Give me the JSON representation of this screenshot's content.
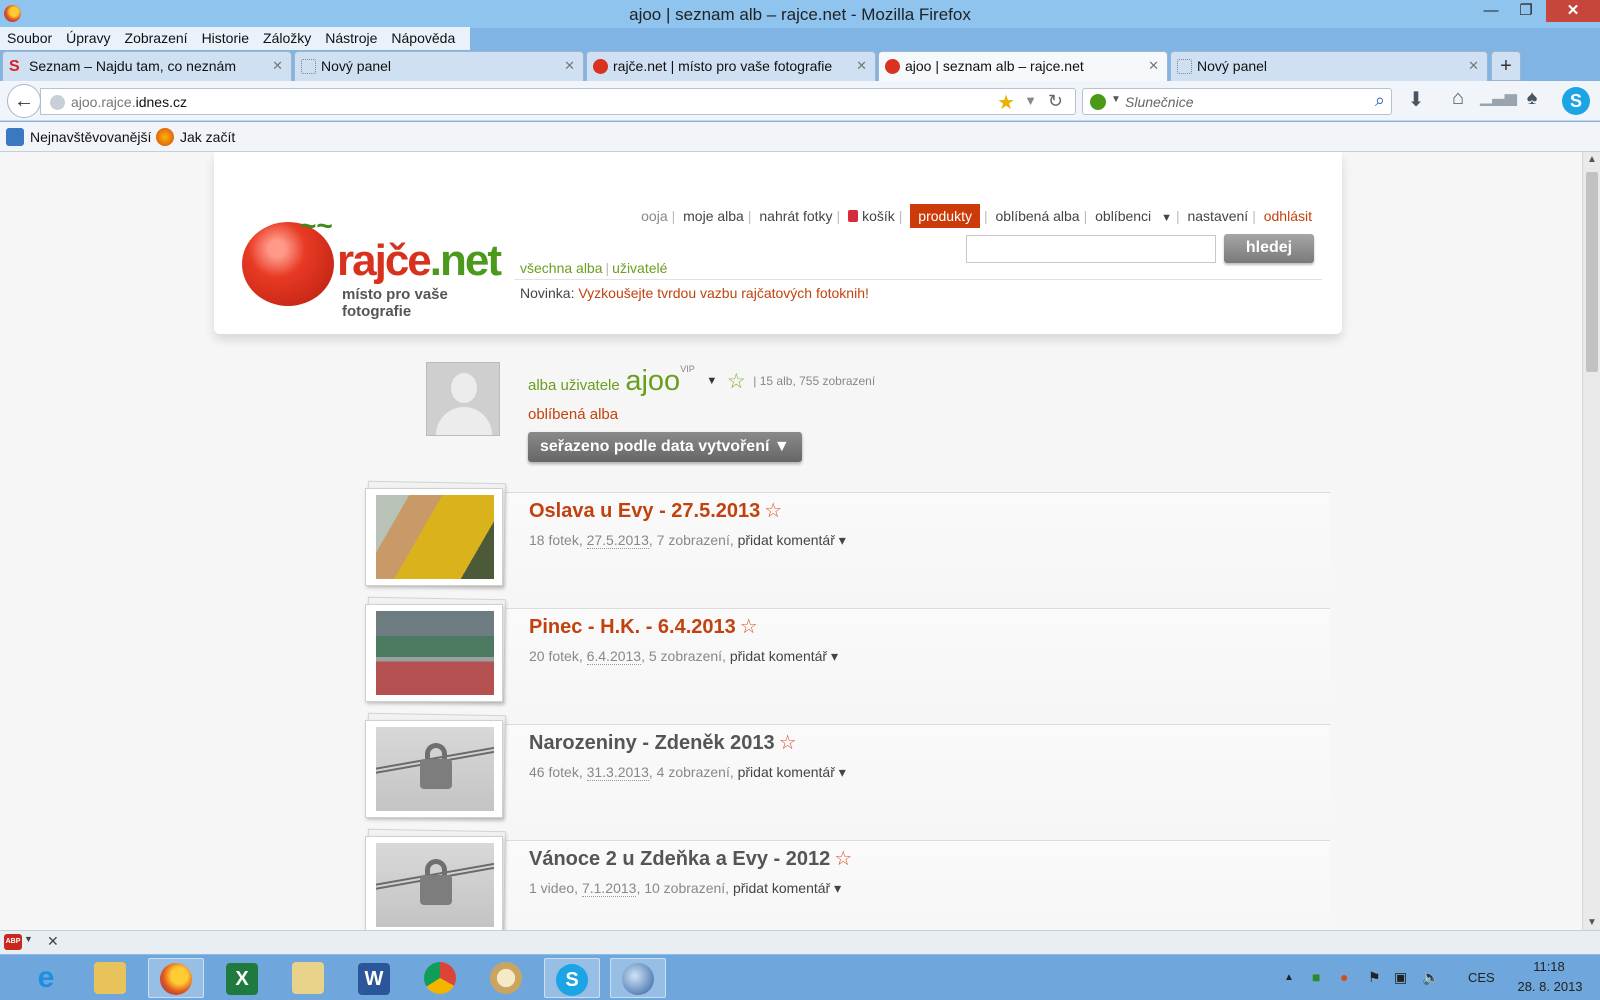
{
  "window": {
    "title": "ajoo | seznam alb – rajce.net - Mozilla Firefox"
  },
  "menu": [
    "Soubor",
    "Úpravy",
    "Zobrazení",
    "Historie",
    "Záložky",
    "Nástroje",
    "Nápověda"
  ],
  "tabs": [
    {
      "label": "Seznam – Najdu tam, co neznám",
      "icon": "seznam-icon"
    },
    {
      "label": "Nový panel",
      "icon": "blank-page-icon"
    },
    {
      "label": "rajče.net | místo pro vaše fotografie",
      "icon": "tomato-icon"
    },
    {
      "label": "ajoo | seznam alb – rajce.net",
      "icon": "tomato-icon",
      "active": true
    },
    {
      "label": "Nový panel",
      "icon": "blank-page-icon"
    }
  ],
  "nav": {
    "url_prefix": "ajoo.rajce.",
    "url_domain": "idnes.cz",
    "search_placeholder": "Slunečnice"
  },
  "bookmarks": [
    {
      "label": "Nejnavštěvovanější",
      "icon": "most-visited-icon"
    },
    {
      "label": "Jak začít",
      "icon": "firefox-icon"
    }
  ],
  "site": {
    "brand_main": "rajče",
    "brand_tld": ".net",
    "tagline": "místo pro vaše fotografie",
    "topnav": {
      "user": "ooja",
      "my_albums": "moje alba",
      "upload": "nahrát fotky",
      "cart": "košík",
      "products": "produkty",
      "fav_albums": "oblíbená alba",
      "favourites": "oblíbenci",
      "settings": "nastavení",
      "logout": "odhlásit"
    },
    "search_button": "hledej",
    "subnav": {
      "all_albums": "všechna alba",
      "users": "uživatelé"
    },
    "news_label": "Novinka:",
    "news_text": "Vyzkoušejte tvrdou vazbu rajčatových fotoknih!",
    "accent": "#c2420e",
    "green": "#6a9e1f"
  },
  "profile": {
    "prefix": "alba uživatele",
    "username": "ajoo",
    "badge": "VIP",
    "stats": "15 alb, 755 zobrazení",
    "fav_albums": "oblíbená alba",
    "sort_label": "seřazeno podle data vytvoření ▼"
  },
  "albums": [
    {
      "title": "Oslava u Evy - 27.5.2013",
      "count": "18 fotek,",
      "date": "27.5.2013",
      "views": ", 7 zobrazení,",
      "comment": "přidat komentář ▾",
      "locked": false
    },
    {
      "title": "Pinec - H.K. - 6.4.2013",
      "count": "20 fotek,",
      "date": "6.4.2013",
      "views": ", 5 zobrazení,",
      "comment": "přidat komentář ▾",
      "locked": false
    },
    {
      "title": "Narozeniny - Zdeněk 2013",
      "count": "46 fotek,",
      "date": "31.3.2013",
      "views": ", 4 zobrazení,",
      "comment": "přidat komentář ▾",
      "locked": true
    },
    {
      "title": "Vánoce 2 u Zdeňka a Evy - 2012",
      "count": "1 video,",
      "date": "7.1.2013",
      "views": ", 10 zobrazení,",
      "comment": "přidat komentář ▾",
      "locked": true
    }
  ],
  "addon": {
    "abp_label": "ABP"
  },
  "taskbar": {
    "apps": [
      "internet-explorer-icon",
      "file-explorer-icon",
      "firefox-icon",
      "excel-icon",
      "outlook-icon",
      "word-icon",
      "chrome-icon",
      "paint-icon",
      "skype-icon",
      "thunderbird-icon"
    ],
    "lang": "CES",
    "time": "11:18",
    "date": "28. 8. 2013"
  }
}
